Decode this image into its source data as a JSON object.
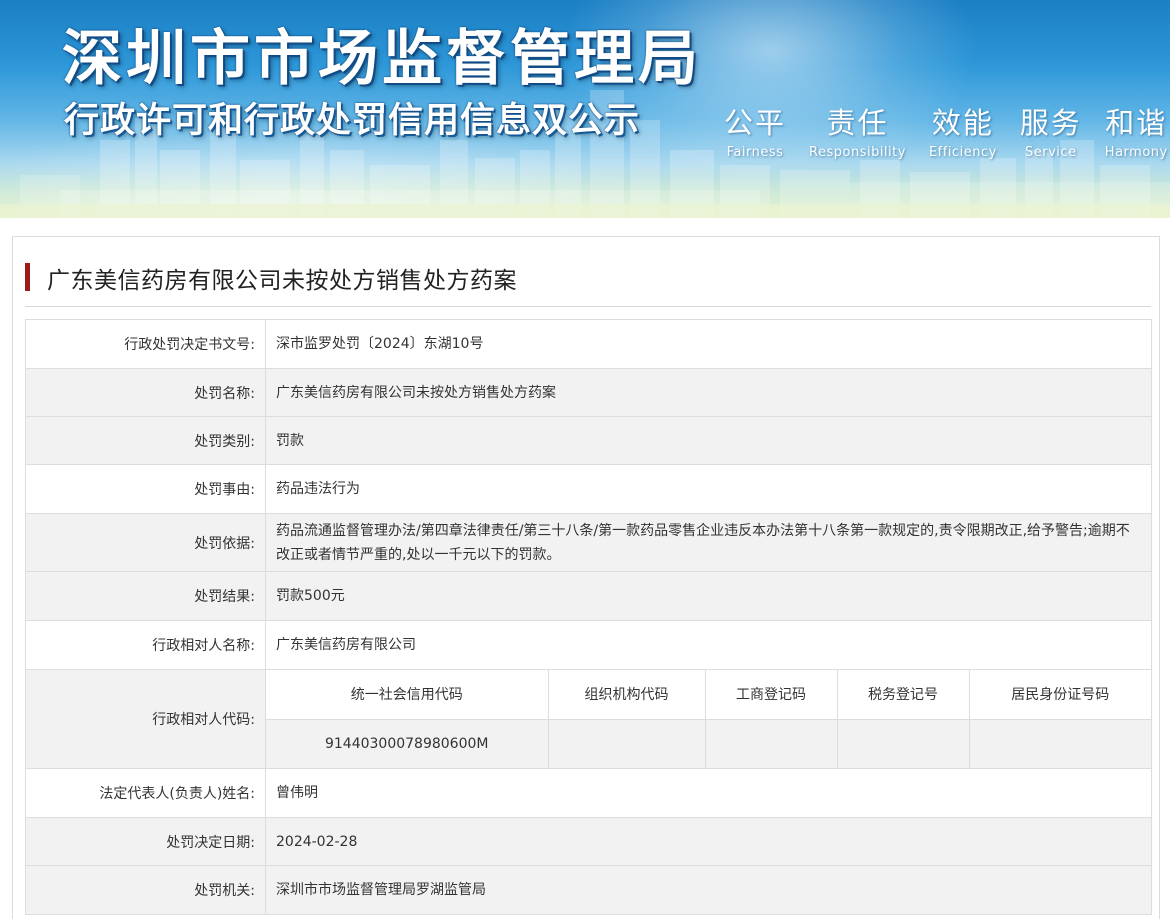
{
  "banner": {
    "title": "深圳市市场监督管理局",
    "subtitle": "行政许可和行政处罚信用信息双公示",
    "values": [
      {
        "cn": "公平",
        "en": "Fairness"
      },
      {
        "cn": "责任",
        "en": "Responsibility"
      },
      {
        "cn": "效能",
        "en": "Efficiency"
      },
      {
        "cn": "服务",
        "en": "Service"
      },
      {
        "cn": "和谐",
        "en": "Harmony"
      }
    ]
  },
  "case": {
    "title": "广东美信药房有限公司未按处方销售处方药案"
  },
  "details": [
    {
      "label": "行政处罚决定书文号:",
      "value": "深市监罗处罚〔2024〕东湖10号"
    },
    {
      "label": "处罚名称:",
      "value": "广东美信药房有限公司未按处方销售处方药案"
    },
    {
      "label": "处罚类别:",
      "value": "罚款"
    },
    {
      "label": "处罚事由:",
      "value": "药品违法行为"
    },
    {
      "label": "处罚依据:",
      "value": "药品流通监督管理办法/第四章法律责任/第三十八条/第一款药品零售企业违反本办法第十八条第一款规定的,责令限期改正,给予警告;逾期不改正或者情节严重的,处以一千元以下的罚款。"
    },
    {
      "label": "处罚结果:",
      "value": "罚款500元"
    },
    {
      "label": "行政相对人名称:",
      "value": "广东美信药房有限公司"
    }
  ],
  "party_codes": {
    "label": "行政相对人代码:",
    "headers": [
      "统一社会信用代码",
      "组织机构代码",
      "工商登记码",
      "税务登记号",
      "居民身份证号码"
    ],
    "values": [
      "91440300078980600M",
      "",
      "",
      "",
      ""
    ]
  },
  "details_after": [
    {
      "label": "法定代表人(负责人)姓名:",
      "value": "曾伟明"
    },
    {
      "label": "处罚决定日期:",
      "value": "2024-02-28"
    },
    {
      "label": "处罚机关:",
      "value": "深圳市市场监督管理局罗湖监管局"
    }
  ]
}
